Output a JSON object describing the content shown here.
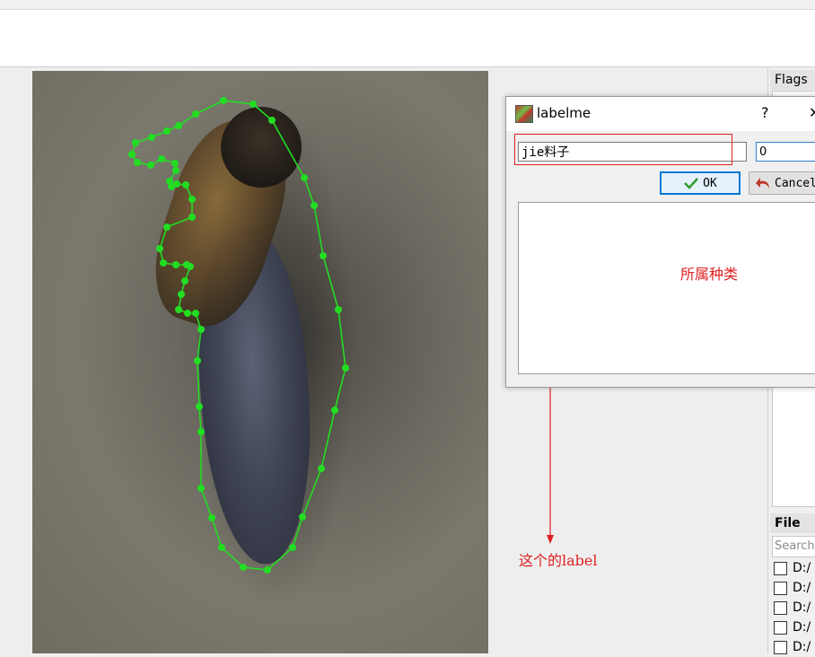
{
  "dialog": {
    "title": "labelme",
    "help_glyph": "?",
    "close_glyph": "✕",
    "label_value": "jie料子",
    "group_id_value": "0",
    "ok_label": "OK",
    "cancel_label": "Cancel",
    "ok_icon": "checkmark-icon",
    "cancel_icon": "undo-arrow-icon"
  },
  "dock": {
    "flags_title": "Flags",
    "file_list_title": "File List",
    "search_placeholder": "Search Filename",
    "files": [
      "D:/",
      "D:/",
      "D:/",
      "D:/",
      "D:/"
    ]
  },
  "annotations": {
    "category_note": "所属种类",
    "label_note": "这个的label",
    "color": "#e02020"
  },
  "polygon": {
    "color": "#22dd22"
  }
}
